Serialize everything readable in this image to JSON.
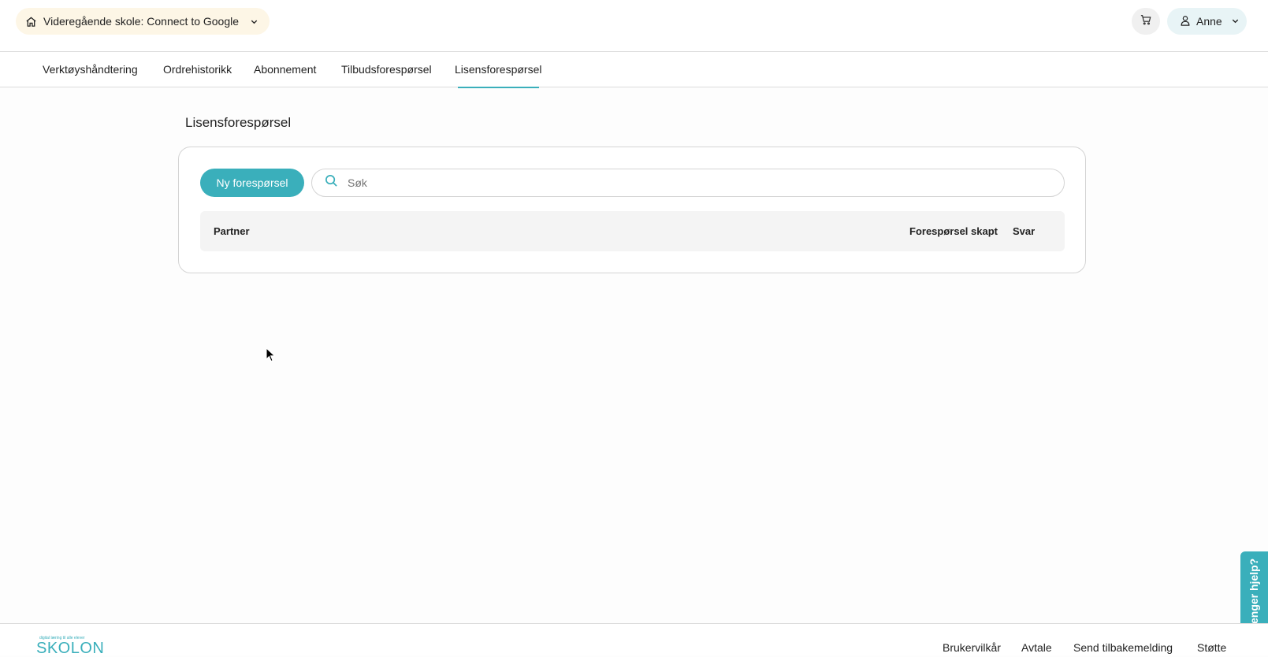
{
  "header": {
    "school_selector": {
      "label": "Videregående skole: Connect to Google",
      "icon": "home-icon"
    },
    "cart": {
      "icon": "cart-icon"
    },
    "user": {
      "name": "Anne",
      "icon": "user-icon"
    }
  },
  "tabs": [
    {
      "label": "Verktøyshåndtering",
      "active": false
    },
    {
      "label": "Ordrehistorikk",
      "active": false
    },
    {
      "label": "Abonnement",
      "active": false
    },
    {
      "label": "Tilbudsforespørsel",
      "active": false
    },
    {
      "label": "Lisensforespørsel",
      "active": true
    }
  ],
  "main": {
    "title": "Lisensforespørsel",
    "new_request_label": "Ny forespørsel",
    "search": {
      "placeholder": "Søk",
      "value": ""
    },
    "table": {
      "columns": [
        "Partner",
        "Forespørsel skapt",
        "Svar"
      ],
      "rows": []
    }
  },
  "footer": {
    "logo": {
      "tagline": "digital læring til alle elever",
      "text": "SKOLON"
    },
    "links": [
      "Brukervilkår",
      "Avtale",
      "Send tilbakemelding",
      "Støtte"
    ]
  },
  "help": {
    "label": "Trenger hjelp?"
  },
  "colors": {
    "accent": "#3aafbb",
    "school_selector_bg": "#fdf6e6",
    "user_menu_bg": "#e8f4f6"
  }
}
